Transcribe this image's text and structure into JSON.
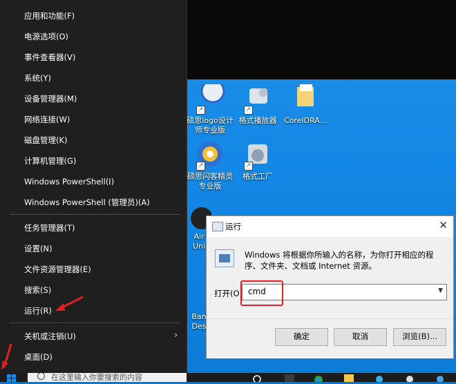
{
  "winx_menu": {
    "items": [
      {
        "label": "应用和功能(F)"
      },
      {
        "label": "电源选项(O)"
      },
      {
        "label": "事件查看器(V)"
      },
      {
        "label": "系统(Y)"
      },
      {
        "label": "设备管理器(M)"
      },
      {
        "label": "网络连接(W)"
      },
      {
        "label": "磁盘管理(K)"
      },
      {
        "label": "计算机管理(G)"
      },
      {
        "label": "Windows PowerShell(I)"
      },
      {
        "label": "Windows PowerShell (管理员)(A)"
      },
      {
        "label": "任务管理器(T)"
      },
      {
        "label": "设置(N)"
      },
      {
        "label": "文件资源管理器(E)"
      },
      {
        "label": "搜索(S)"
      },
      {
        "label": "运行(R)"
      },
      {
        "label": "关机或注销(U)"
      },
      {
        "label": "桌面(D)"
      }
    ],
    "submenu_chevron": "›"
  },
  "desktop_icons": [
    {
      "label": "硕思logo设计师专业版",
      "icon": "logo-designer-icon"
    },
    {
      "label": "格式播放器",
      "icon": "player-icon"
    },
    {
      "label": "CorelDRA...",
      "icon": "folder-icon"
    },
    {
      "label": "硕思闪客精灵专业版",
      "icon": "gear-flash-icon"
    },
    {
      "label": "格式工厂",
      "icon": "format-factory-icon"
    },
    {
      "label": "Airt...",
      "partial": "Air",
      "partial2": "Uni"
    },
    {
      "label": "Band...",
      "partial": "Ban",
      "partial2": "Des"
    }
  ],
  "run_dialog": {
    "title": "运行",
    "close_glyph": "✕",
    "description": "Windows 将根据你所输入的名称，为你打开相应的程序、文件夹、文档或 Internet 资源。",
    "open_label": "打开(O):",
    "input_value": "cmd",
    "dropdown_glyph": "▼",
    "buttons": {
      "ok": "确定",
      "cancel": "取消",
      "browse": "浏览(B)..."
    }
  },
  "taskbar": {
    "search_placeholder": "在这里输入你要搜索的内容"
  },
  "colors": {
    "menu_bg": "#1f1f1f",
    "desktop_blue": "#1488e6",
    "highlight_red": "#e02020"
  }
}
